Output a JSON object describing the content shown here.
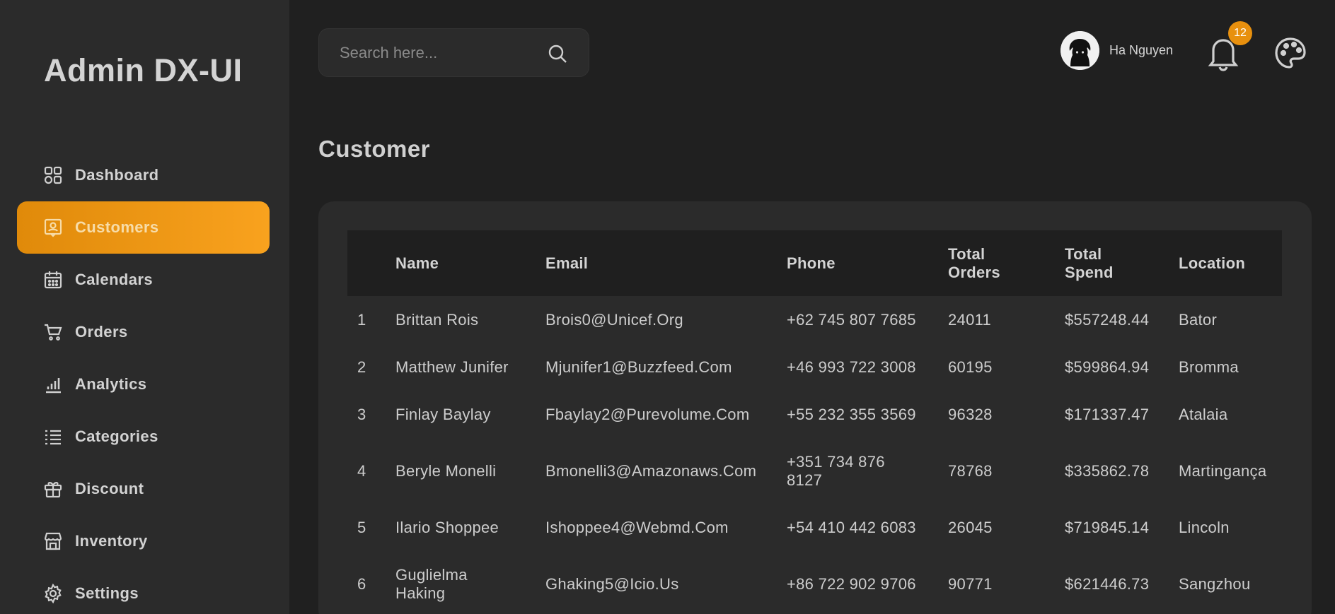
{
  "brand": "Admin DX-UI",
  "sidebar": {
    "items": [
      {
        "label": "Dashboard",
        "icon": "dashboard-icon"
      },
      {
        "label": "Customers",
        "icon": "customer-card-icon",
        "active": true
      },
      {
        "label": "Calendars",
        "icon": "calendar-icon"
      },
      {
        "label": "Orders",
        "icon": "cart-icon"
      },
      {
        "label": "Analytics",
        "icon": "bar-chart-icon"
      },
      {
        "label": "Categories",
        "icon": "list-icon"
      },
      {
        "label": "Discount",
        "icon": "gift-icon"
      },
      {
        "label": "Inventory",
        "icon": "store-icon"
      },
      {
        "label": "Settings",
        "icon": "gear-icon"
      }
    ]
  },
  "header": {
    "search_placeholder": "Search here...",
    "user_name": "Ha Nguyen",
    "notification_count": "12"
  },
  "page": {
    "title": "Customer"
  },
  "table": {
    "headers": [
      "",
      "Name",
      "Email",
      "Phone",
      "Total Orders",
      "Total Spend",
      "Location"
    ],
    "rows": [
      [
        "1",
        "Brittan Rois",
        "Brois0@Unicef.Org",
        "+62 745 807 7685",
        "24011",
        "$557248.44",
        "Bator"
      ],
      [
        "2",
        "Matthew Junifer",
        "Mjunifer1@Buzzfeed.Com",
        "+46 993 722 3008",
        "60195",
        "$599864.94",
        "Bromma"
      ],
      [
        "3",
        "Finlay Baylay",
        "Fbaylay2@Purevolume.Com",
        "+55 232 355 3569",
        "96328",
        "$171337.47",
        "Atalaia"
      ],
      [
        "4",
        "Beryle Monelli",
        "Bmonelli3@Amazonaws.Com",
        "+351 734 876 8127",
        "78768",
        "$335862.78",
        "Martingança"
      ],
      [
        "5",
        "Ilario Shoppee",
        "Ishoppee4@Webmd.Com",
        "+54 410 442 6083",
        "26045",
        "$719845.14",
        "Lincoln"
      ],
      [
        "6",
        "Guglielma Haking",
        "Ghaking5@Icio.Us",
        "+86 722 902 9706",
        "90771",
        "$621446.73",
        "Sangzhou"
      ]
    ]
  },
  "colors": {
    "accent": "#f29a18",
    "background": "#202020",
    "panel": "#2b2b2b"
  }
}
